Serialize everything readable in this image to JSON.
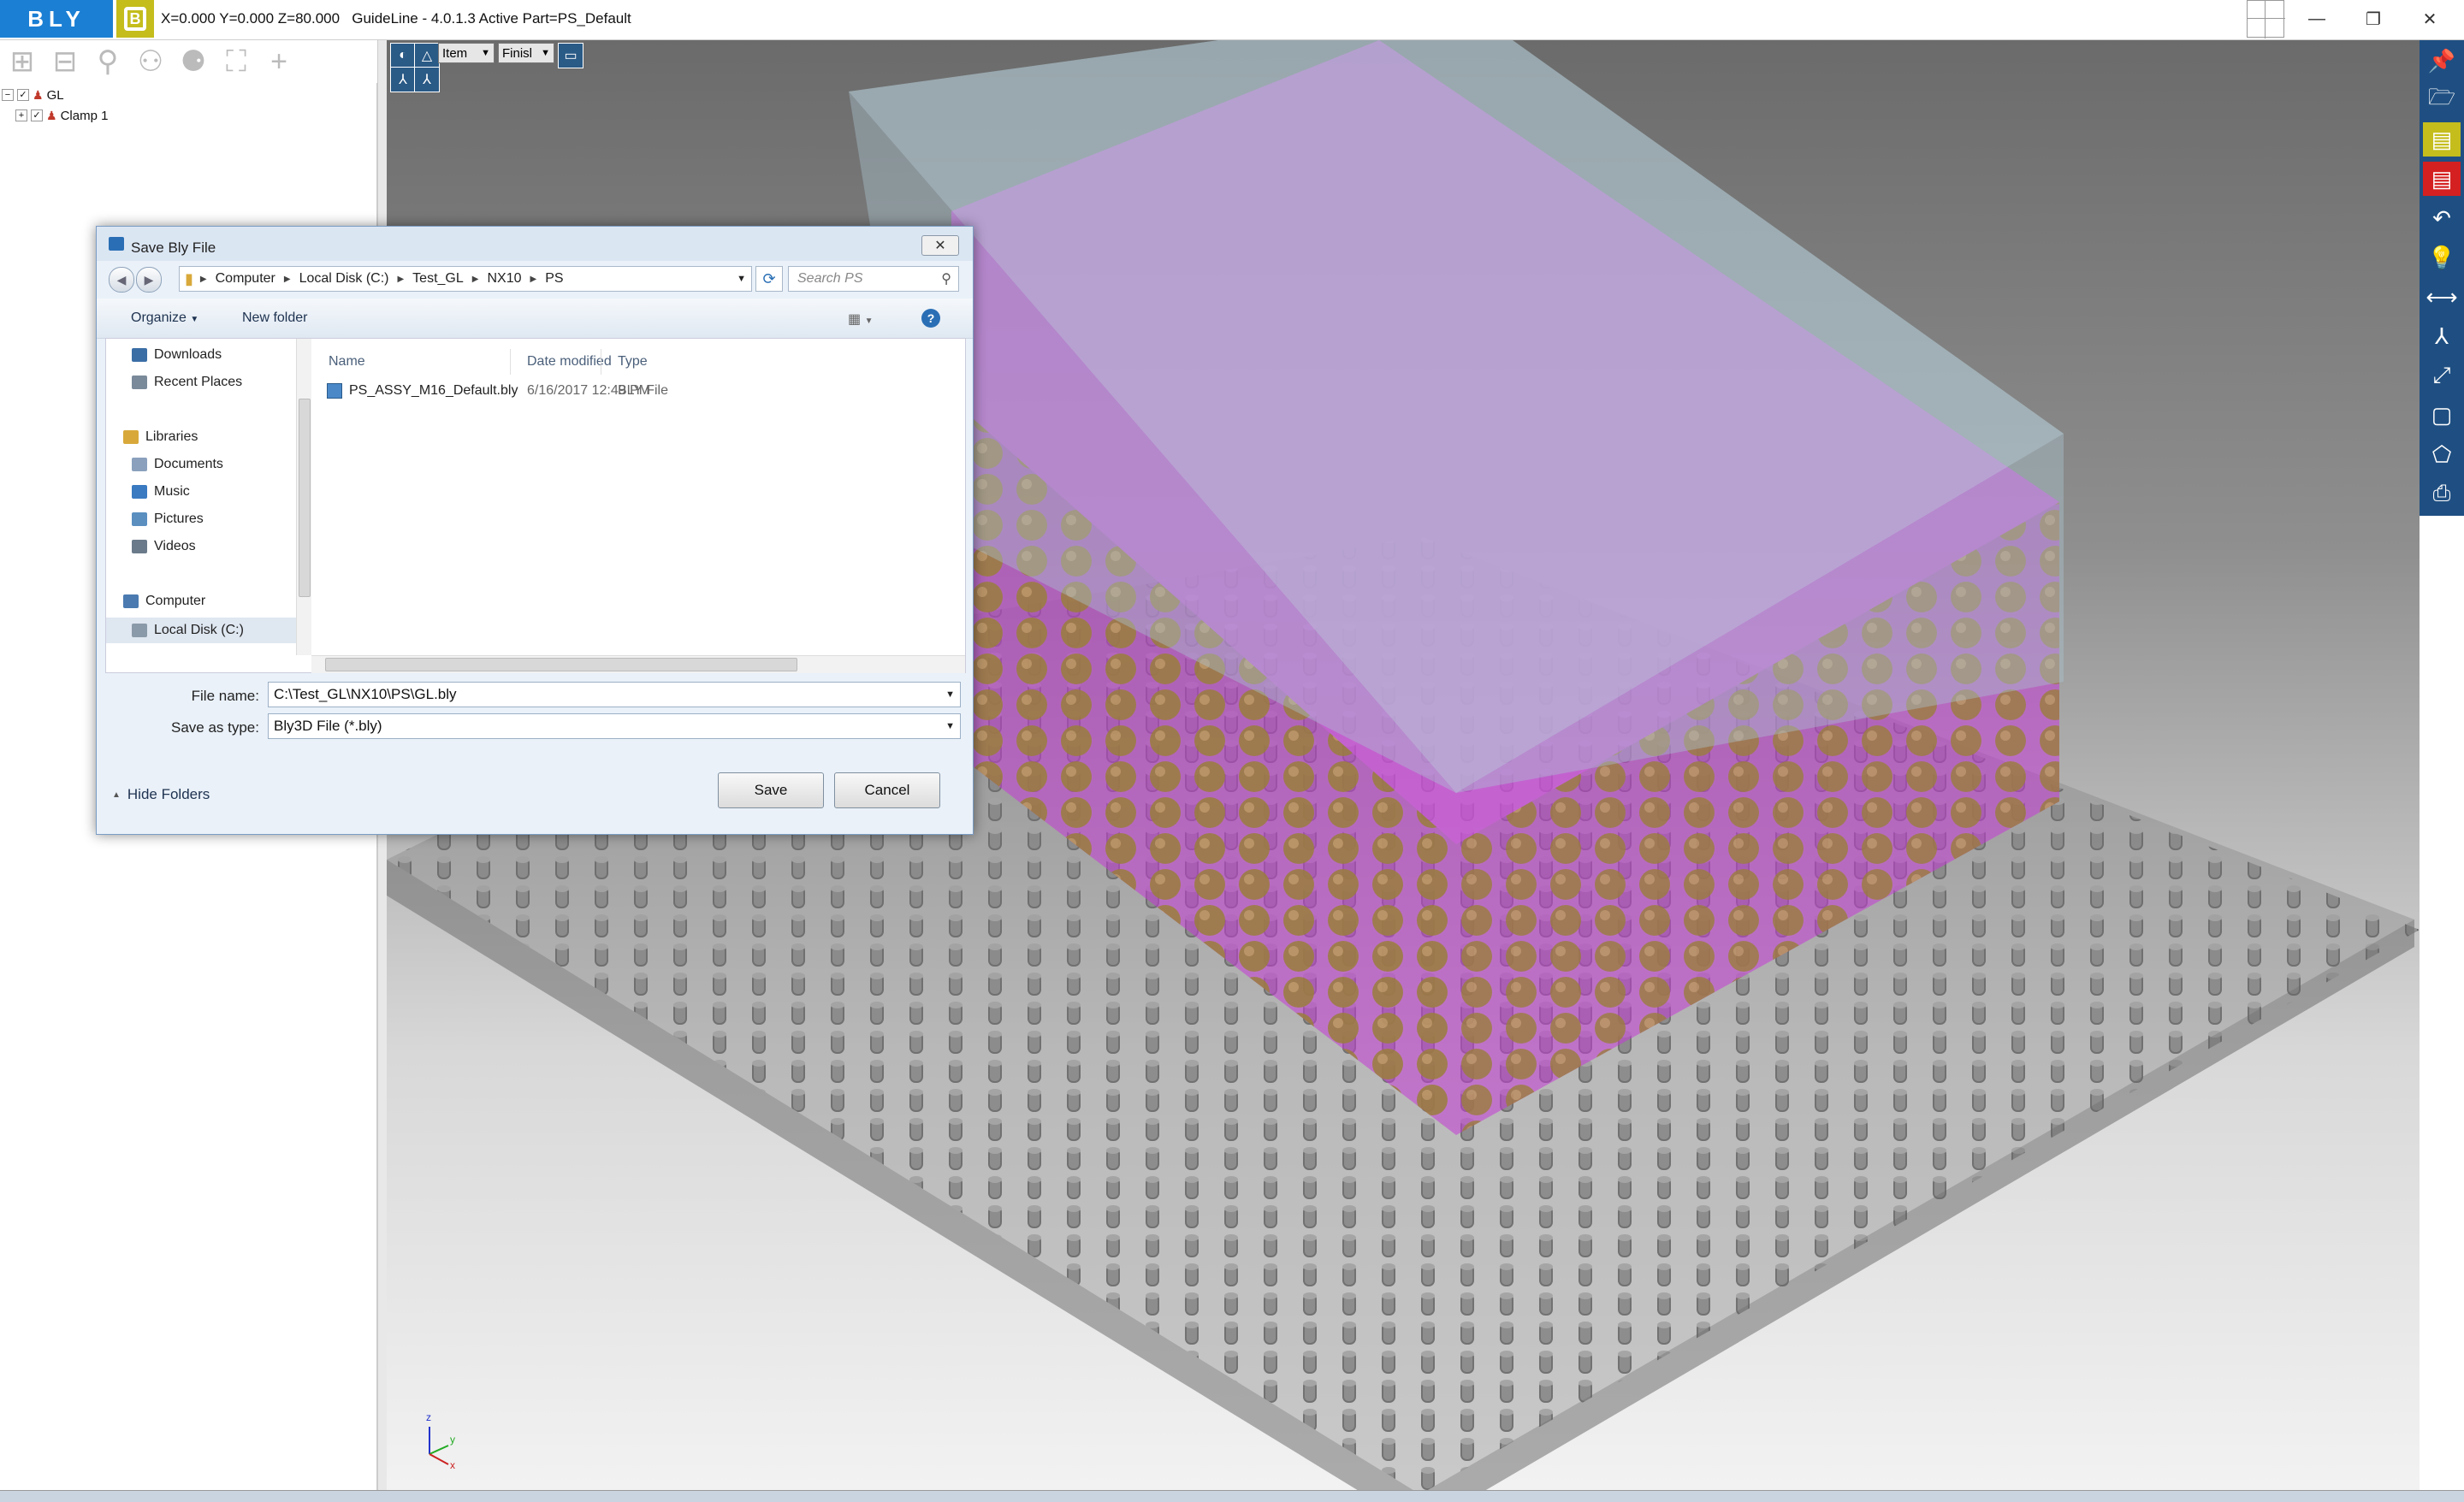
{
  "app": {
    "logo_text": "BLY",
    "b_logo_text": "B",
    "title": "X=0.000 Y=0.000 Z=80.000   GuideLine - 4.0.1.3 Active Part=PS_Default",
    "colors": {
      "accent_blue": "#1b7fd4",
      "logo_yellow": "#c4bd1c",
      "toolbar_navy": "#1f4f82",
      "magenta_part": "#cc33dd"
    }
  },
  "window_controls": {
    "minimize": "—",
    "maximize": "❐",
    "close": "✕"
  },
  "tree_toolbar_icons": [
    "expand-icon",
    "collapse-icon",
    "search-icon",
    "add-node-icon",
    "tree-icon",
    "fit-icon",
    "plus-icon"
  ],
  "tree": {
    "items": [
      {
        "label": "GL",
        "checked": true,
        "expand": "−"
      },
      {
        "label": "Clamp 1",
        "checked": true,
        "expand": "+"
      }
    ]
  },
  "viewport_toolbar": {
    "item_combo": "Item",
    "finish_combo": "Finisl"
  },
  "right_toolbar_icons": [
    "pin-icon",
    "open-folder-icon",
    "b-yellow-icon",
    "b-red-icon",
    "undo-icon",
    "bulb-icon",
    "measure-icon",
    "axis-icon",
    "fit-view-icon",
    "window-icon",
    "shape-icon",
    "print-icon"
  ],
  "dialog": {
    "title": "Save Bly File",
    "close": "✕",
    "breadcrumbs": [
      "Computer",
      "Local Disk (C:)",
      "Test_GL",
      "NX10",
      "PS"
    ],
    "search_placeholder": "Search PS",
    "organize": "Organize",
    "new_folder": "New folder",
    "nav": [
      {
        "label": "Downloads",
        "color": "#3a6ea5"
      },
      {
        "label": "Recent Places",
        "color": "#7a8a9a"
      },
      {
        "label": "Libraries",
        "color": "#d8a93a"
      },
      {
        "label": "Documents",
        "color": "#8aa0bd"
      },
      {
        "label": "Music",
        "color": "#3a7ac0"
      },
      {
        "label": "Pictures",
        "color": "#5a8fc0"
      },
      {
        "label": "Videos",
        "color": "#6a7a8a"
      },
      {
        "label": "Computer",
        "color": "#4a7ab0"
      },
      {
        "label": "Local Disk (C:)",
        "color": "#8a9aa8"
      }
    ],
    "columns": {
      "name": "Name",
      "date": "Date modified",
      "type": "Type"
    },
    "files": [
      {
        "name": "PS_ASSY_M16_Default.bly",
        "date": "6/16/2017 12:49 PM",
        "type": "BLY File"
      }
    ],
    "file_name_label": "File name:",
    "file_name_value": "C:\\Test_GL\\NX10\\PS\\GL.bly",
    "save_type_label": "Save as type:",
    "save_type_value": "Bly3D File (*.bly)",
    "save": "Save",
    "cancel": "Cancel",
    "hide_folders": "Hide Folders"
  },
  "axis_labels": {
    "z": "z",
    "y": "y",
    "x": "x"
  }
}
